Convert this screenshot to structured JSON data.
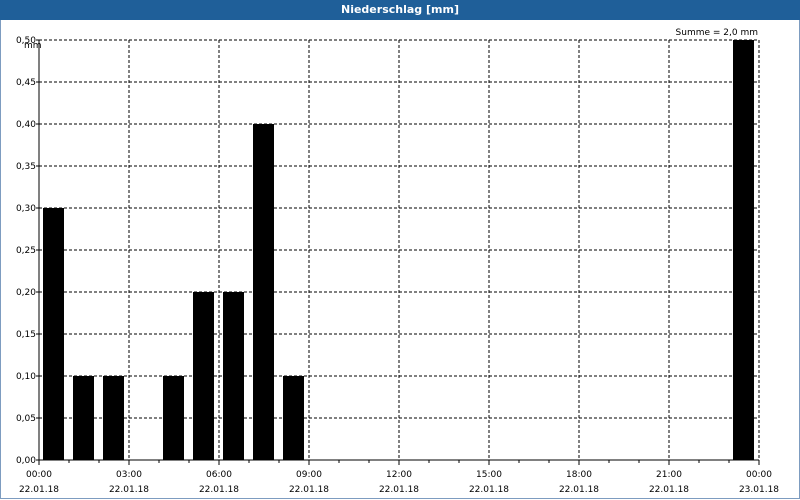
{
  "title": "Niederschlag [mm]",
  "sum_label": "Summe = 2,0 mm",
  "chart_data": {
    "type": "bar",
    "title": "Niederschlag [mm]",
    "ylabel": "mm",
    "ylim": [
      0,
      0.5
    ],
    "yticks": [
      "0,00",
      "0,05",
      "0,10",
      "0,15",
      "0,20",
      "0,25",
      "0,30",
      "0,35",
      "0,40",
      "0,45",
      "0,50"
    ],
    "xlim_hours": [
      0,
      24
    ],
    "xticks": [
      {
        "hour": 0,
        "time": "00:00",
        "date": "22.01.18"
      },
      {
        "hour": 3,
        "time": "03:00",
        "date": "22.01.18"
      },
      {
        "hour": 6,
        "time": "06:00",
        "date": "22.01.18"
      },
      {
        "hour": 9,
        "time": "09:00",
        "date": "22.01.18"
      },
      {
        "hour": 12,
        "time": "12:00",
        "date": "22.01.18"
      },
      {
        "hour": 15,
        "time": "15:00",
        "date": "22.01.18"
      },
      {
        "hour": 18,
        "time": "18:00",
        "date": "22.01.18"
      },
      {
        "hour": 21,
        "time": "21:00",
        "date": "22.01.18"
      },
      {
        "hour": 24,
        "time": "00:00",
        "date": "23.01.18"
      }
    ],
    "bars": [
      {
        "hour": 0,
        "value": 0.3
      },
      {
        "hour": 1,
        "value": 0.1
      },
      {
        "hour": 2,
        "value": 0.1
      },
      {
        "hour": 3,
        "value": 0.0
      },
      {
        "hour": 4,
        "value": 0.1
      },
      {
        "hour": 5,
        "value": 0.2
      },
      {
        "hour": 6,
        "value": 0.2
      },
      {
        "hour": 7,
        "value": 0.4
      },
      {
        "hour": 8,
        "value": 0.1
      },
      {
        "hour": 23,
        "value": 0.5
      }
    ],
    "grid": true,
    "bar_color": "#000000"
  }
}
